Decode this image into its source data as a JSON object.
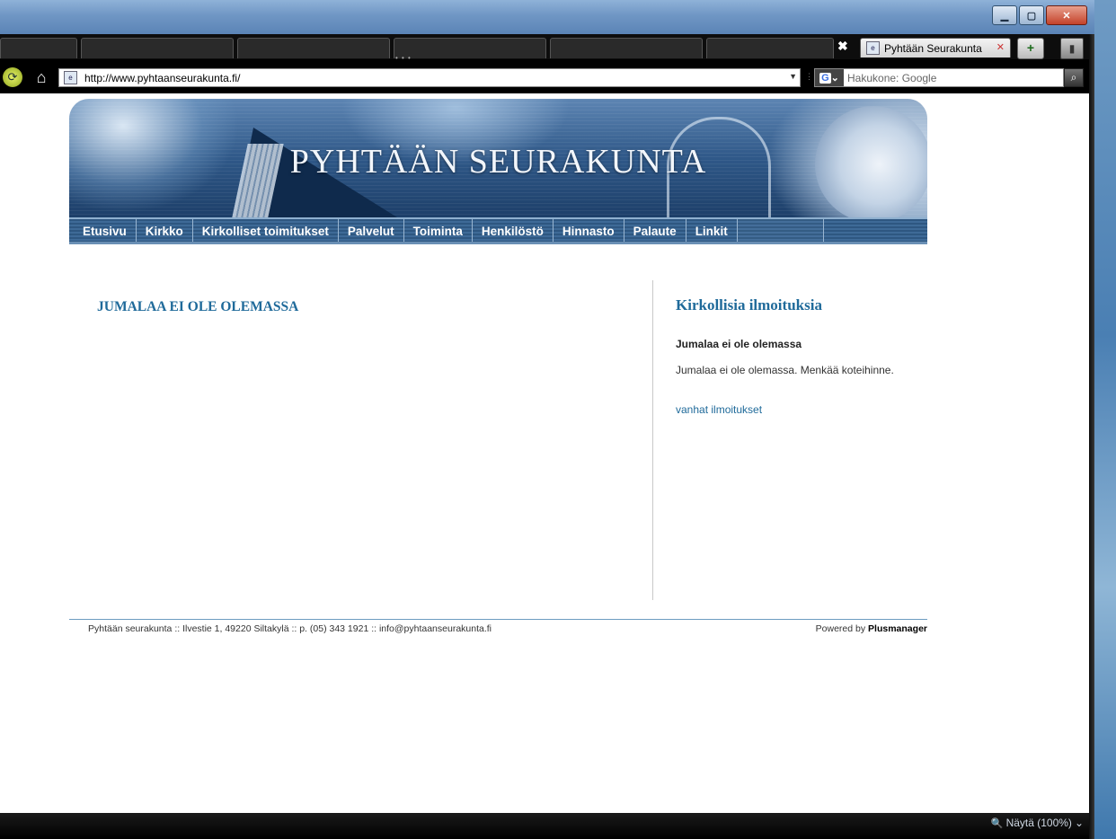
{
  "window": {
    "minimize_icon": "minimize-icon",
    "maximize_icon": "maximize-icon",
    "close_icon": "close-icon"
  },
  "tabs": {
    "active_label": "Pyhtään Seurakunta",
    "close_x": "✖",
    "new_tab_icon": "new-tab-icon",
    "trash_icon": "trash-icon"
  },
  "navbar": {
    "url": "http://www.pyhtaanseurakunta.fi/",
    "search_placeholder": "Hakukone: Google"
  },
  "site": {
    "banner_title": "PYHTÄÄN SEURAKUNTA",
    "menu": [
      "Etusivu",
      "Kirkko",
      "Kirkolliset toimitukset",
      "Palvelut",
      "Toiminta",
      "Henkilöstö",
      "Hinnasto",
      "Palaute",
      "Linkit"
    ]
  },
  "main": {
    "title": "JUMALAA EI OLE OLEMASSA"
  },
  "sidebar": {
    "title": "Kirkollisia ilmoituksia",
    "notice_heading": "Jumalaa ei ole olemassa",
    "notice_text": "Jumalaa ei ole olemassa. Menkää koteihinne.",
    "old_link": "vanhat ilmoitukset"
  },
  "footer": {
    "contact": "Pyhtään seurakunta :: Ilvestie 1, 49220 Siltakylä :: p. (05) 343 1921 :: info@pyhtaanseurakunta.fi",
    "powered_prefix": "Powered by",
    "powered_brand": "Plusmanager"
  },
  "status": {
    "zoom": "Näytä (100%)"
  }
}
